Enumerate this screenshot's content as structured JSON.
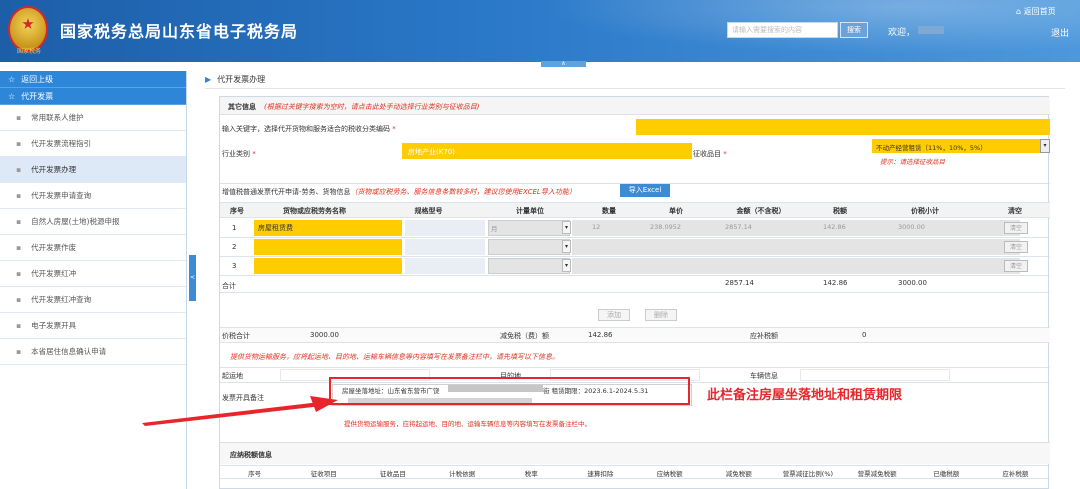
{
  "header": {
    "emblem_text": "国家税务",
    "title": "国家税务总局山东省电子税务局",
    "search_placeholder": "请输入需要搜索的内容",
    "search_button": "搜索",
    "welcome": "欢迎，",
    "home": "返回首页",
    "logout": "退出",
    "collapse": "∧"
  },
  "sidebar": {
    "back": "返回上级",
    "group": "代开发票",
    "items": [
      "常用联系人维护",
      "代开发票流程指引",
      "代开发票办理",
      "代开发票申请查询",
      "自然人房屋(土地)税源申报",
      "代开发票作废",
      "代开发票红冲",
      "代开发票红冲查询",
      "电子发票开具",
      "本省居住信息确认申请"
    ],
    "active_index": 2,
    "toggle": "<"
  },
  "breadcrumb": "代开发票办理",
  "other_info": {
    "title": "其它信息",
    "hint": "(根据过关键字搜索为空时，请点击此处手动选择行业类别与征收品目)",
    "keyword_label": "输入关键字，选择代开货物和服务适合的税收分类编码",
    "required": "*",
    "industry_label": "行业类别",
    "industry_value": "房地产业(K70)",
    "tax_item_label": "征收品目",
    "tax_item_value": "不动产经营租赁（11%，10%，5%）",
    "tax_item_tip": "提示：请选择征收品目"
  },
  "goods": {
    "title": "增值税普通发票代开申请-劳务、货物信息",
    "note": "（货物或应税劳务、服务信息条数较多时，建议您使用EXCEL导入功能）",
    "import_button": "导入Excel",
    "headers": [
      "序号",
      "货物或应税劳务名称",
      "规格型号",
      "计量单位",
      "数量",
      "单价",
      "金额（不含税）",
      "税额",
      "价税小计",
      "清空"
    ],
    "rows": [
      {
        "no": "1",
        "name": "房屋租赁费",
        "unit": "月",
        "qty": "12",
        "price": "238.0952",
        "amount": "2857.14",
        "tax": "142.86",
        "total": "3000.00",
        "clear": "清空"
      },
      {
        "no": "2",
        "name": "",
        "unit": "",
        "qty": "",
        "price": "",
        "amount": "",
        "tax": "",
        "total": "",
        "clear": "清空"
      },
      {
        "no": "3",
        "name": "",
        "unit": "",
        "qty": "",
        "price": "",
        "amount": "",
        "tax": "",
        "total": "",
        "clear": "清空"
      }
    ],
    "sum_label": "合计",
    "sum_amount": "2857.14",
    "sum_tax": "142.86",
    "sum_total": "3000.00",
    "add_button": "添加",
    "delete_button": "删除"
  },
  "totals": {
    "total_label": "价税合计",
    "total_value": "3000.00",
    "reduce_label": "减免税（费）额",
    "reduce_value": "142.86",
    "supp_label": "应补税额",
    "supp_value": "0"
  },
  "transport": {
    "note": "提供货物运输服务，应将起运地、目的地、运输车辆信息等内容填写在发票备注栏中，请先填写以下信息。",
    "origin_label": "起运地",
    "dest_label": "目的地",
    "vehicle_label": "车辆信息"
  },
  "remark": {
    "label": "发票开具备注",
    "text_a": "房屋坐落地址：山东省东营市广饶",
    "text_b": "街   租赁期限：2023.6.1-2024.5.31",
    "hint": "提供货物运输服务，应将起运地、目的地、运输车辆信息等内容填写在发票备注栏中。"
  },
  "annotation": "此栏备注房屋坐落地址和租赁期限",
  "tax_info": {
    "title": "应纳税额信息",
    "headers": [
      "序号",
      "征收项目",
      "征收品目",
      "计税依据",
      "税率",
      "速算扣除",
      "应纳税额",
      "减免税额",
      "营票减征比例(%)",
      "营票减免税额",
      "已缴税额",
      "应补税额"
    ]
  },
  "colors": {
    "header_blue": "#1d5ea8",
    "sidebar_blue": "#2d86d8",
    "highlight_yellow": "#ffcc00",
    "alert_red": "#e8252b"
  }
}
